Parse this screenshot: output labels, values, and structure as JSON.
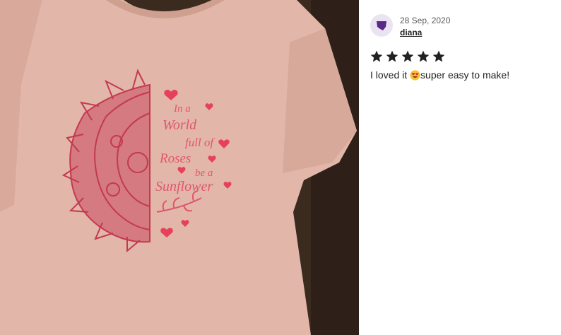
{
  "photo": {
    "icon": "tshirt-photo",
    "design_text": [
      "In a",
      "World",
      "full of",
      "Roses",
      "be a",
      "Sunflower"
    ]
  },
  "review": {
    "date": "28 Sep, 2020",
    "username": "diana",
    "rating": 5,
    "rating_max": 5,
    "text_before": "I loved it ",
    "emoji": "heart-eyes-emoji",
    "text_after": "super easy to make!"
  },
  "colors": {
    "shirt": "#e2b7a9",
    "print": "#c4394f",
    "heart": "#e6405a",
    "avatar_bg": "#eae4f2",
    "avatar_fg": "#5b2a84",
    "star": "#222222"
  }
}
